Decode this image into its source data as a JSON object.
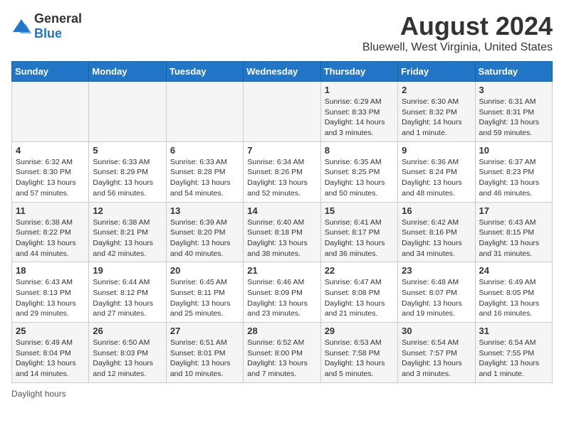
{
  "logo": {
    "general": "General",
    "blue": "Blue"
  },
  "title": "August 2024",
  "subtitle": "Bluewell, West Virginia, United States",
  "days_of_week": [
    "Sunday",
    "Monday",
    "Tuesday",
    "Wednesday",
    "Thursday",
    "Friday",
    "Saturday"
  ],
  "footer": "Daylight hours",
  "weeks": [
    [
      {
        "day": "",
        "info": ""
      },
      {
        "day": "",
        "info": ""
      },
      {
        "day": "",
        "info": ""
      },
      {
        "day": "",
        "info": ""
      },
      {
        "day": "1",
        "info": "Sunrise: 6:29 AM\nSunset: 8:33 PM\nDaylight: 14 hours\nand 3 minutes."
      },
      {
        "day": "2",
        "info": "Sunrise: 6:30 AM\nSunset: 8:32 PM\nDaylight: 14 hours\nand 1 minute."
      },
      {
        "day": "3",
        "info": "Sunrise: 6:31 AM\nSunset: 8:31 PM\nDaylight: 13 hours\nand 59 minutes."
      }
    ],
    [
      {
        "day": "4",
        "info": "Sunrise: 6:32 AM\nSunset: 8:30 PM\nDaylight: 13 hours\nand 57 minutes."
      },
      {
        "day": "5",
        "info": "Sunrise: 6:33 AM\nSunset: 8:29 PM\nDaylight: 13 hours\nand 56 minutes."
      },
      {
        "day": "6",
        "info": "Sunrise: 6:33 AM\nSunset: 8:28 PM\nDaylight: 13 hours\nand 54 minutes."
      },
      {
        "day": "7",
        "info": "Sunrise: 6:34 AM\nSunset: 8:26 PM\nDaylight: 13 hours\nand 52 minutes."
      },
      {
        "day": "8",
        "info": "Sunrise: 6:35 AM\nSunset: 8:25 PM\nDaylight: 13 hours\nand 50 minutes."
      },
      {
        "day": "9",
        "info": "Sunrise: 6:36 AM\nSunset: 8:24 PM\nDaylight: 13 hours\nand 48 minutes."
      },
      {
        "day": "10",
        "info": "Sunrise: 6:37 AM\nSunset: 8:23 PM\nDaylight: 13 hours\nand 46 minutes."
      }
    ],
    [
      {
        "day": "11",
        "info": "Sunrise: 6:38 AM\nSunset: 8:22 PM\nDaylight: 13 hours\nand 44 minutes."
      },
      {
        "day": "12",
        "info": "Sunrise: 6:38 AM\nSunset: 8:21 PM\nDaylight: 13 hours\nand 42 minutes."
      },
      {
        "day": "13",
        "info": "Sunrise: 6:39 AM\nSunset: 8:20 PM\nDaylight: 13 hours\nand 40 minutes."
      },
      {
        "day": "14",
        "info": "Sunrise: 6:40 AM\nSunset: 8:18 PM\nDaylight: 13 hours\nand 38 minutes."
      },
      {
        "day": "15",
        "info": "Sunrise: 6:41 AM\nSunset: 8:17 PM\nDaylight: 13 hours\nand 36 minutes."
      },
      {
        "day": "16",
        "info": "Sunrise: 6:42 AM\nSunset: 8:16 PM\nDaylight: 13 hours\nand 34 minutes."
      },
      {
        "day": "17",
        "info": "Sunrise: 6:43 AM\nSunset: 8:15 PM\nDaylight: 13 hours\nand 31 minutes."
      }
    ],
    [
      {
        "day": "18",
        "info": "Sunrise: 6:43 AM\nSunset: 8:13 PM\nDaylight: 13 hours\nand 29 minutes."
      },
      {
        "day": "19",
        "info": "Sunrise: 6:44 AM\nSunset: 8:12 PM\nDaylight: 13 hours\nand 27 minutes."
      },
      {
        "day": "20",
        "info": "Sunrise: 6:45 AM\nSunset: 8:11 PM\nDaylight: 13 hours\nand 25 minutes."
      },
      {
        "day": "21",
        "info": "Sunrise: 6:46 AM\nSunset: 8:09 PM\nDaylight: 13 hours\nand 23 minutes."
      },
      {
        "day": "22",
        "info": "Sunrise: 6:47 AM\nSunset: 8:08 PM\nDaylight: 13 hours\nand 21 minutes."
      },
      {
        "day": "23",
        "info": "Sunrise: 6:48 AM\nSunset: 8:07 PM\nDaylight: 13 hours\nand 19 minutes."
      },
      {
        "day": "24",
        "info": "Sunrise: 6:49 AM\nSunset: 8:05 PM\nDaylight: 13 hours\nand 16 minutes."
      }
    ],
    [
      {
        "day": "25",
        "info": "Sunrise: 6:49 AM\nSunset: 8:04 PM\nDaylight: 13 hours\nand 14 minutes."
      },
      {
        "day": "26",
        "info": "Sunrise: 6:50 AM\nSunset: 8:03 PM\nDaylight: 13 hours\nand 12 minutes."
      },
      {
        "day": "27",
        "info": "Sunrise: 6:51 AM\nSunset: 8:01 PM\nDaylight: 13 hours\nand 10 minutes."
      },
      {
        "day": "28",
        "info": "Sunrise: 6:52 AM\nSunset: 8:00 PM\nDaylight: 13 hours\nand 7 minutes."
      },
      {
        "day": "29",
        "info": "Sunrise: 6:53 AM\nSunset: 7:58 PM\nDaylight: 13 hours\nand 5 minutes."
      },
      {
        "day": "30",
        "info": "Sunrise: 6:54 AM\nSunset: 7:57 PM\nDaylight: 13 hours\nand 3 minutes."
      },
      {
        "day": "31",
        "info": "Sunrise: 6:54 AM\nSunset: 7:55 PM\nDaylight: 13 hours\nand 1 minute."
      }
    ]
  ]
}
